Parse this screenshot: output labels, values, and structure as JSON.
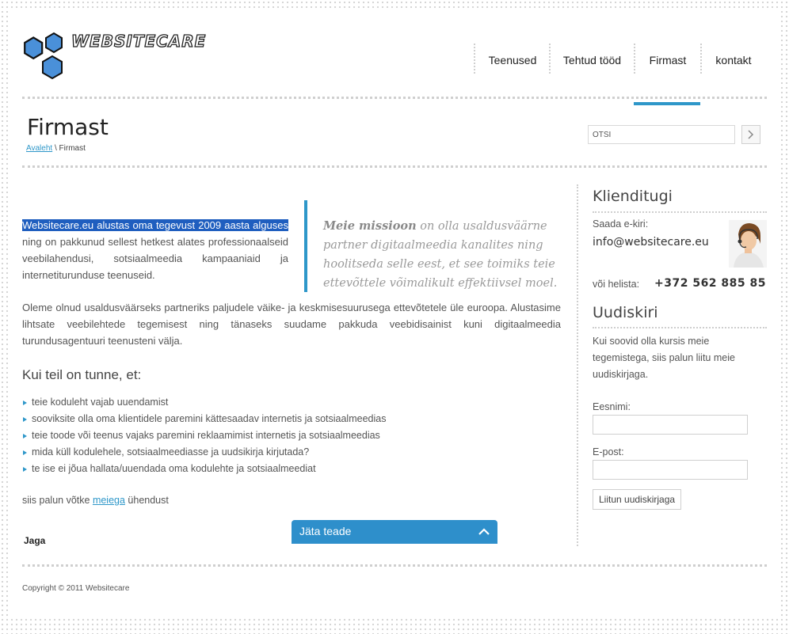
{
  "logo": {
    "text": "WEBSITECARE"
  },
  "nav": {
    "items": [
      {
        "label": "Teenused"
      },
      {
        "label": "Tehtud tööd"
      },
      {
        "label": "Firmast"
      },
      {
        "label": "kontakt"
      }
    ],
    "active_index": 2
  },
  "page": {
    "title": "Firmast"
  },
  "breadcrumb": {
    "home": "Avaleht",
    "separator": " \\ ",
    "current": "Firmast"
  },
  "search": {
    "value": "OTSI"
  },
  "content": {
    "p1_highlight": "Websitecare.eu alustas oma tegevust 2009 aasta alguses",
    "p1_rest": " ning on pakkunud sellest hetkest alates professionaalseid veebilahendusi, sotsiaalmeedia kampaaniaid ja internetiturunduse teenuseid.",
    "quote_bold": "Meie missioon",
    "quote_rest": " on olla usaldusväärne partner digitaalmeedia kanalites ning hoolitseda selle eest, et see toimiks teie ettevõttele võimalikult effektiivsel moel.",
    "p2": "Oleme olnud usaldusväärseks partneriks paljudele väike- ja keskmisesuurusega ettevõtetele üle euroopa. Alustasime lihtsate veebilehtede tegemisest ning tänaseks suudame pakkuda veebidisainist kuni digitaalmeedia turundusagentuuri teenusteni välja.",
    "heading": "Kui teil on tunne, et:",
    "list": [
      "teie koduleht vajab uuendamist",
      "sooviksite olla oma klientidele paremini kättesaadav internetis ja sotsiaalmeedias",
      "teie toode või teenus vajaks paremini reklaamimist internetis ja sotsiaalmeedias",
      "mida küll kodulehele, sotsiaalmeediasse ja uudsikirja kirjutada?",
      "te ise ei jõua hallata/uuendada oma kodulehte ja sotsiaalmeediat"
    ],
    "contact_before": "siis palun võtke ",
    "contact_link": "meiega",
    "contact_after": " ühendust",
    "share": "Jaga"
  },
  "feedback": {
    "label": "Jäta teade"
  },
  "sidebar": {
    "support_title": "Klienditugi",
    "email_label": "Saada e-kiri:",
    "email": "info@websitecare.eu",
    "phone_label": "või helista:",
    "phone": "+372 562 885 85",
    "newsletter_title": "Uudiskiri",
    "newsletter_text": "Kui soovid olla kursis meie tegemistega, siis palun liitu meie uudiskirjaga.",
    "first_name_label": "Eesnimi:",
    "email_field_label": "E-post:",
    "subscribe_button": "Liitun uudiskirjaga"
  },
  "footer": {
    "copyright": "Copyright © 2011 Websitecare"
  },
  "colors": {
    "accent": "#2e97c9",
    "highlight": "#1f5ebf"
  },
  "icons": {
    "search_button": "chevron-right-icon",
    "feedback_toggle": "chevron-up-icon"
  }
}
